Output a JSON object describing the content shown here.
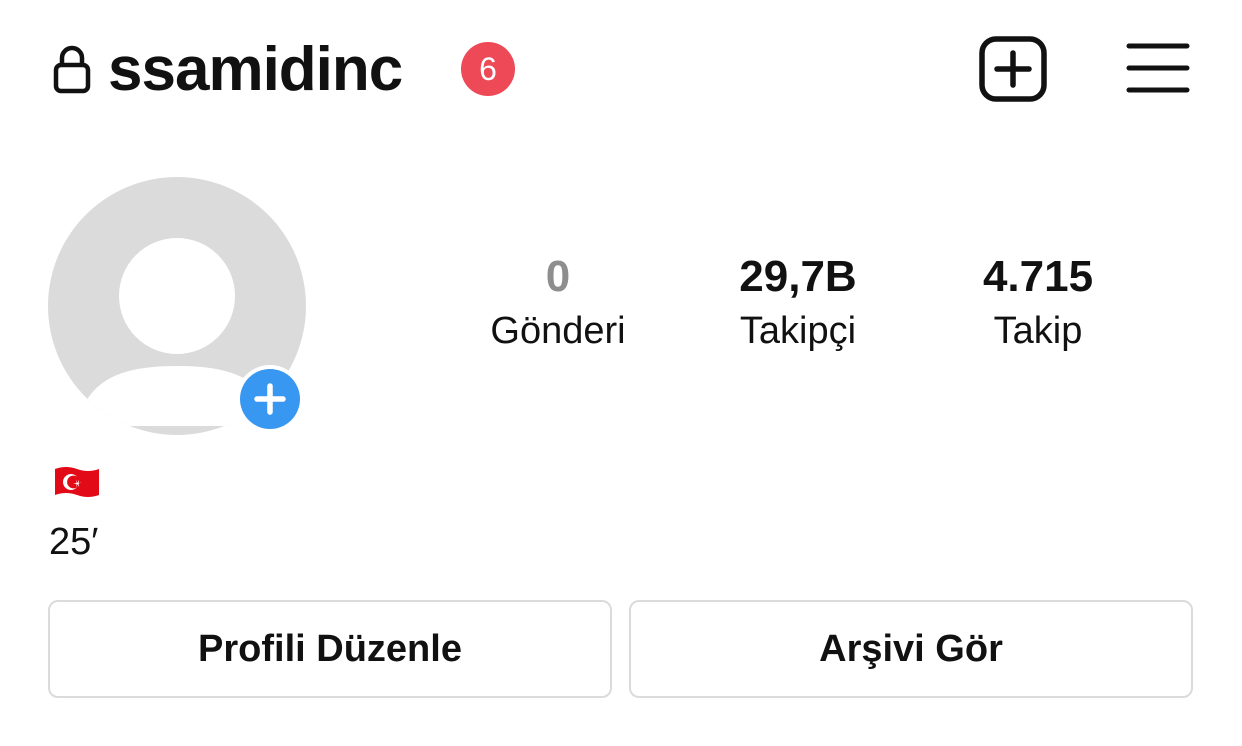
{
  "header": {
    "username": "ssamidinc",
    "notification_count": "6",
    "lock_icon": "lock-icon",
    "new_post_icon": "plus-square-icon",
    "menu_icon": "hamburger-menu-icon"
  },
  "profile": {
    "avatar_icon": "default-avatar-icon",
    "add_icon": "plus-circle-icon",
    "stats": {
      "posts": {
        "value": "0",
        "label": "Gönderi"
      },
      "followers": {
        "value": "29,7B",
        "label": "Takipçi"
      },
      "following": {
        "value": "4.715",
        "label": "Takip"
      }
    },
    "bio": {
      "flag": "turkey-flag-emoji",
      "text": "25′"
    }
  },
  "buttons": {
    "edit_profile": "Profili Düzenle",
    "view_archive": "Arşivi Gör"
  },
  "colors": {
    "badge": "#ed4956",
    "add_button": "#3897f0",
    "avatar_bg": "#dbdbdb",
    "border": "#dbdbdb",
    "flag_red": "#e30a17"
  }
}
